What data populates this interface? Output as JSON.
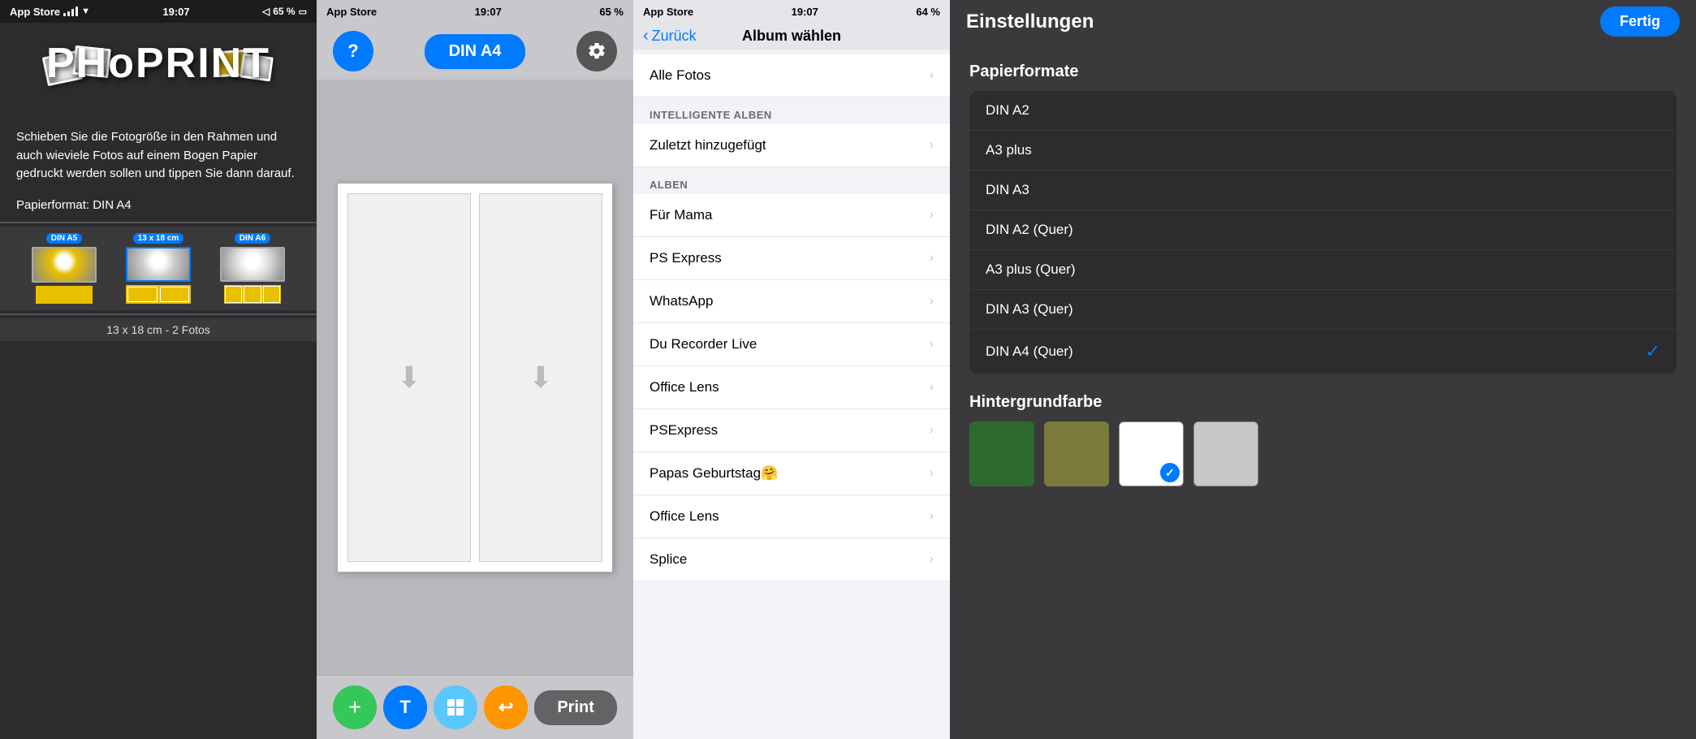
{
  "panel1": {
    "status": {
      "time": "19:07",
      "carrier": "App Store",
      "signal": 4,
      "wifi": true,
      "battery": "65 %"
    },
    "description": "Schieben Sie die Fotogröße in den Rahmen und auch wieviele Fotos auf einem Bogen Papier gedruckt werden sollen und tippen Sie dann darauf.",
    "paper_format_label": "Papierformat: DIN A4",
    "sizes": [
      {
        "label": "DIN A5",
        "selected": false
      },
      {
        "label": "13 x 18 cm",
        "selected": true
      },
      {
        "label": "DIN A6",
        "selected": false
      }
    ],
    "footer": "13 x 18 cm - 2 Fotos"
  },
  "panel2": {
    "status": {
      "time": "19:07",
      "carrier": "App Store",
      "battery": "65 %"
    },
    "format_btn": "DIN A4",
    "help_btn": "?",
    "settings_btn": "⚙",
    "add_btn": "+",
    "text_btn": "T",
    "layout_btn": "⊞",
    "share_btn": "↩",
    "print_btn": "Print"
  },
  "panel3": {
    "status": {
      "time": "19:07",
      "carrier": "App Store",
      "battery": "64 %"
    },
    "back_btn": "Zurück",
    "title": "Album wählen",
    "all_photos": "Alle Fotos",
    "smart_albums_header": "INTELLIGENTE ALBEN",
    "recently_added": "Zuletzt hinzugefügt",
    "albums_header": "ALBEN",
    "albums": [
      "Für Mama",
      "PS Express",
      "WhatsApp",
      "Du Recorder Live",
      "Office Lens",
      "PSExpress",
      "Papas Geburtstag🤗",
      "Office Lens",
      "Splice"
    ]
  },
  "panel4": {
    "title": "Einstellungen",
    "done_btn": "Fertig",
    "paper_formats_section": "Papierformate",
    "paper_formats": [
      {
        "label": "DIN A2",
        "selected": false
      },
      {
        "label": "A3 plus",
        "selected": false
      },
      {
        "label": "DIN A3",
        "selected": false
      },
      {
        "label": "DIN A2  (Quer)",
        "selected": false
      },
      {
        "label": "A3 plus  (Quer)",
        "selected": false
      },
      {
        "label": "DIN A3  (Quer)",
        "selected": false
      },
      {
        "label": "DIN A4  (Quer)",
        "selected": true
      }
    ],
    "bg_color_section": "Hintergrundfarbe",
    "bg_colors": [
      {
        "name": "dark-green",
        "hex": "#2d6a2d",
        "selected": false
      },
      {
        "name": "olive",
        "hex": "#7a7a3a",
        "selected": false
      },
      {
        "name": "white",
        "hex": "#ffffff",
        "selected": true
      },
      {
        "name": "light-gray",
        "hex": "#c8c8c8",
        "selected": false
      }
    ]
  }
}
